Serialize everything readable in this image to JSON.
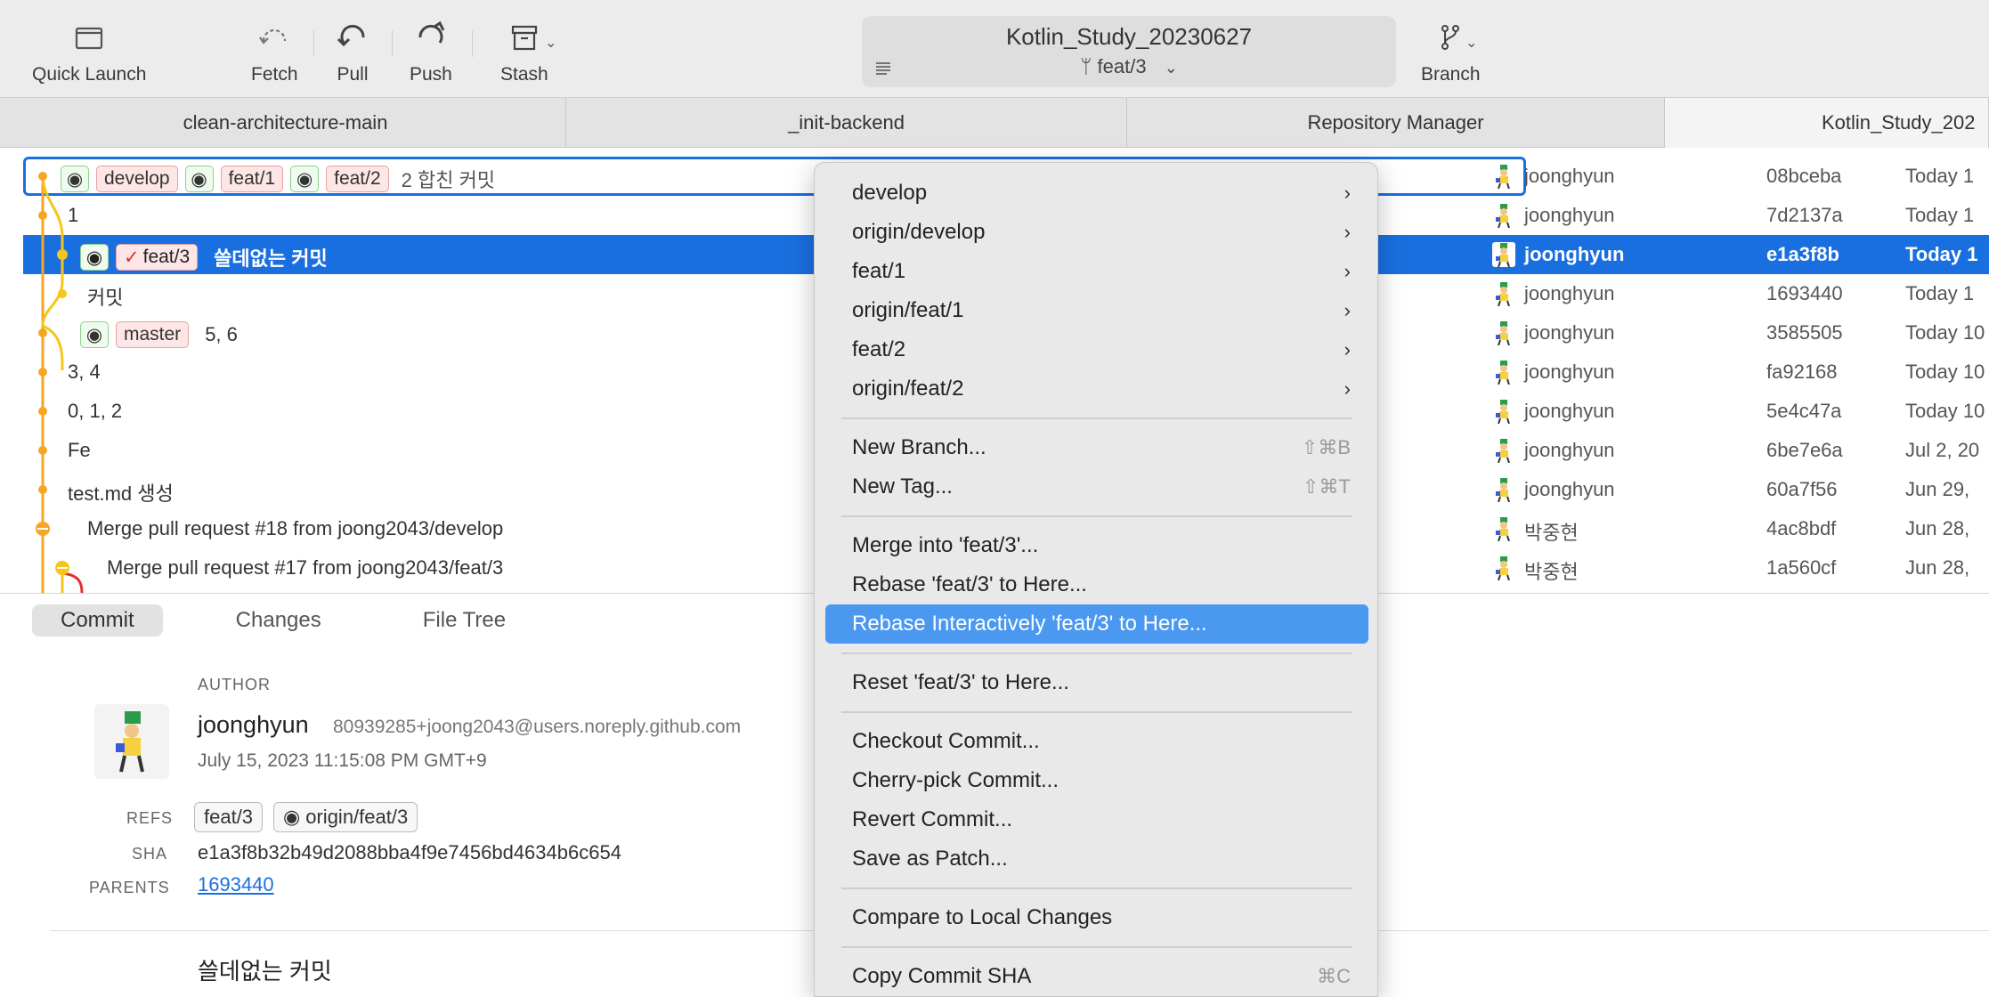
{
  "toolbar": {
    "quick_launch": "Quick Launch",
    "fetch": "Fetch",
    "pull": "Pull",
    "push": "Push",
    "stash": "Stash",
    "branch": "Branch",
    "repo_title": "Kotlin_Study_20230627",
    "current_branch": "feat/3"
  },
  "tabs": [
    {
      "label": "clean-architecture-main"
    },
    {
      "label": "_init-backend"
    },
    {
      "label": "Repository Manager"
    },
    {
      "label": "Kotlin_Study_202"
    }
  ],
  "commits": [
    {
      "refs": [
        "develop",
        "feat/1",
        "feat/2"
      ],
      "message": "2 합친 커밋",
      "author": "joonghyun",
      "sha": "08bceba",
      "date": "Today 1"
    },
    {
      "refs": [],
      "message": "1",
      "author": "joonghyun",
      "sha": "7d2137a",
      "date": "Today 1"
    },
    {
      "refs": [
        "feat/3"
      ],
      "message": "쓸데없는 커밋",
      "author": "joonghyun",
      "sha": "e1a3f8b",
      "date": "Today 1"
    },
    {
      "refs": [],
      "message": "커밋",
      "author": "joonghyun",
      "sha": "1693440",
      "date": "Today 1"
    },
    {
      "refs": [
        "master"
      ],
      "message": "5, 6",
      "author": "joonghyun",
      "sha": "3585505",
      "date": "Today 10"
    },
    {
      "refs": [],
      "message": "3, 4",
      "author": "joonghyun",
      "sha": "fa92168",
      "date": "Today 10"
    },
    {
      "refs": [],
      "message": "0, 1, 2",
      "author": "joonghyun",
      "sha": "5e4c47a",
      "date": "Today 10"
    },
    {
      "refs": [],
      "message": "Fe",
      "author": "joonghyun",
      "sha": "6be7e6a",
      "date": "Jul 2, 20"
    },
    {
      "refs": [],
      "message": "test.md 생성",
      "author": "joonghyun",
      "sha": "60a7f56",
      "date": "Jun 29,"
    },
    {
      "refs": [],
      "message": "Merge pull request #18 from joong2043/develop",
      "author": "박중현",
      "sha": "4ac8bdf",
      "date": "Jun 28,"
    },
    {
      "refs": [],
      "message": "Merge pull request #17 from joong2043/feat/3",
      "author": "박중현",
      "sha": "1a560cf",
      "date": "Jun 28,"
    }
  ],
  "detail": {
    "tabs": [
      "Commit",
      "Changes",
      "File Tree"
    ],
    "author_label": "AUTHOR",
    "author_name": "joonghyun",
    "author_email": "80939285+joong2043@users.noreply.github.com",
    "author_date": "July 15, 2023 11:15:08 PM GMT+9",
    "refs_label": "REFS",
    "refs": [
      "feat/3",
      "origin/feat/3"
    ],
    "sha_label": "SHA",
    "sha": "e1a3f8b32b49d2088bba4f9e7456bd4634b6c654",
    "parents_label": "PARENTS",
    "parent": "1693440",
    "message": "쓸데없는 커밋"
  },
  "context_menu": {
    "submenus": [
      "develop",
      "origin/develop",
      "feat/1",
      "origin/feat/1",
      "feat/2",
      "origin/feat/2"
    ],
    "new_branch": "New Branch...",
    "new_branch_shortcut": "⇧⌘B",
    "new_tag": "New Tag...",
    "new_tag_shortcut": "⇧⌘T",
    "merge": "Merge into 'feat/3'...",
    "rebase": "Rebase 'feat/3' to Here...",
    "rebase_interactive": "Rebase Interactively 'feat/3' to Here...",
    "reset": "Reset 'feat/3' to Here...",
    "checkout": "Checkout Commit...",
    "cherry_pick": "Cherry-pick Commit...",
    "revert": "Revert Commit...",
    "save_patch": "Save as Patch...",
    "compare": "Compare to Local Changes",
    "copy_sha": "Copy Commit SHA",
    "copy_sha_shortcut": "⌘C",
    "submenu_arrow": "›"
  },
  "colors": {
    "selection": "#1a6fe0",
    "menu_highlight": "#4a98f0",
    "graph_main": "#f5a623",
    "graph_branch": "#f5c518",
    "graph_red": "#e0302a"
  }
}
